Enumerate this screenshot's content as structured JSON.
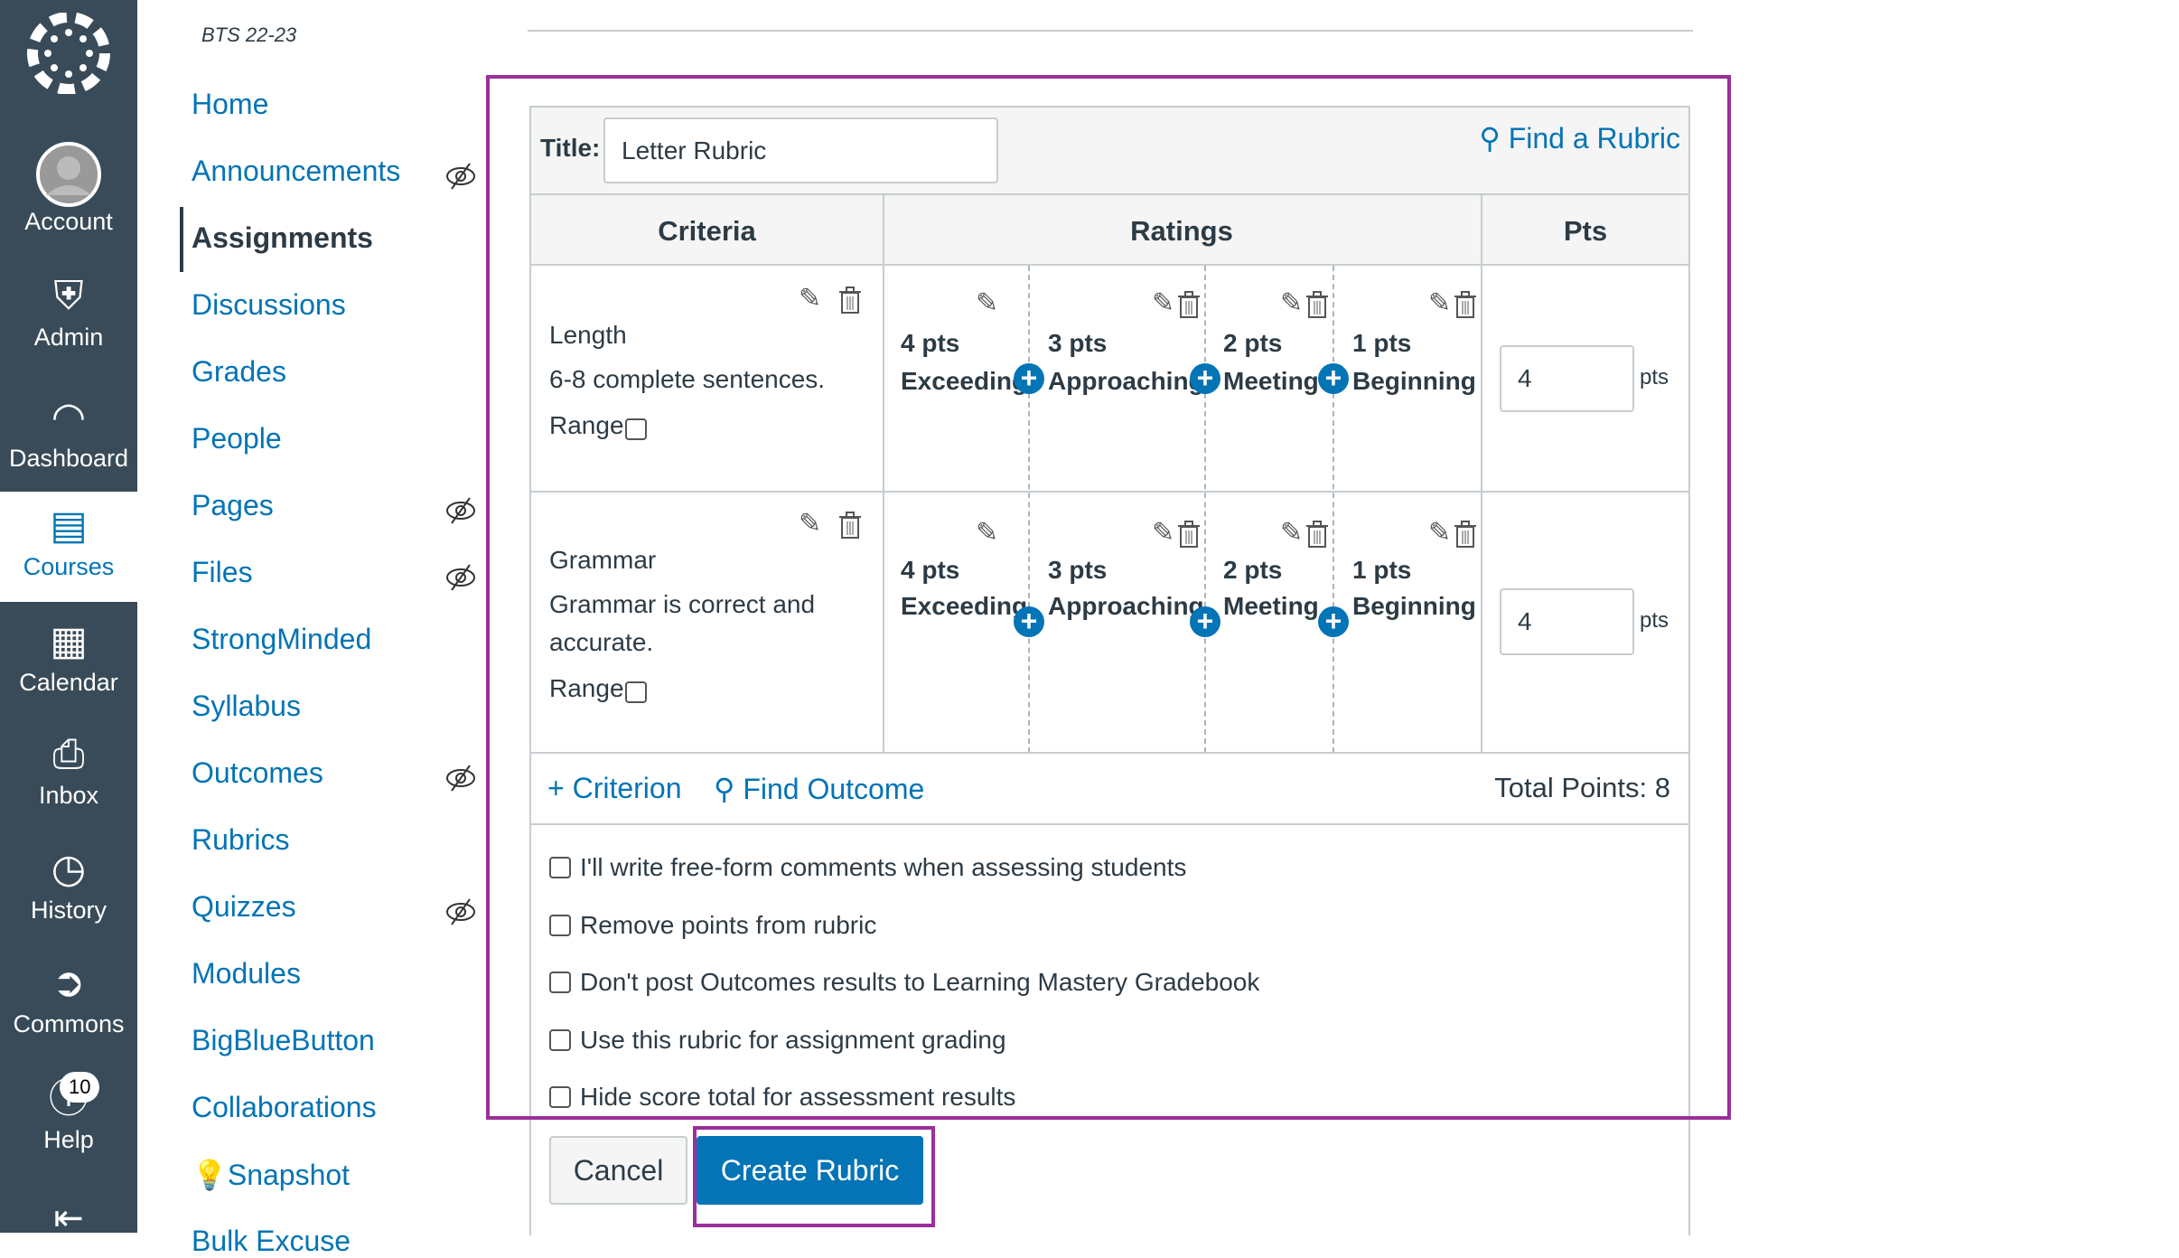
{
  "global_nav": {
    "items": [
      {
        "label": "Account",
        "icon": "user-avatar-icon"
      },
      {
        "label": "Admin",
        "icon": "shield-key-icon"
      },
      {
        "label": "Dashboard",
        "icon": "speedometer-icon"
      },
      {
        "label": "Courses",
        "icon": "book-icon",
        "active": true
      },
      {
        "label": "Calendar",
        "icon": "calendar-icon"
      },
      {
        "label": "Inbox",
        "icon": "inbox-icon"
      },
      {
        "label": "History",
        "icon": "clock-icon"
      },
      {
        "label": "Commons",
        "icon": "commons-icon"
      },
      {
        "label": "Help",
        "icon": "help-icon",
        "badge": "10"
      }
    ],
    "brand_color": "#394b58"
  },
  "course_nav": {
    "course_term": "BTS 22-23",
    "items": [
      {
        "label": "Home"
      },
      {
        "label": "Announcements",
        "hidden": true
      },
      {
        "label": "Assignments",
        "active": true
      },
      {
        "label": "Discussions"
      },
      {
        "label": "Grades"
      },
      {
        "label": "People"
      },
      {
        "label": "Pages",
        "hidden": true
      },
      {
        "label": "Files",
        "hidden": true
      },
      {
        "label": "StrongMinded"
      },
      {
        "label": "Syllabus"
      },
      {
        "label": "Outcomes",
        "hidden": true
      },
      {
        "label": "Rubrics"
      },
      {
        "label": "Quizzes",
        "hidden": true
      },
      {
        "label": "Modules"
      },
      {
        "label": "BigBlueButton"
      },
      {
        "label": "Collaborations"
      },
      {
        "label": "Snapshot"
      },
      {
        "label": "Bulk Excuse"
      }
    ]
  },
  "rubric": {
    "title_label": "Title:",
    "title_value": "Letter Rubric",
    "find_rubric": "Find a Rubric",
    "headers": {
      "criteria": "Criteria",
      "ratings": "Ratings",
      "pts": "Pts"
    },
    "criteria": [
      {
        "name": "Length",
        "description": [
          "6-8 complete sentences."
        ],
        "range_label": "Range",
        "points": "4",
        "pts_unit": "pts",
        "ratings": [
          {
            "pts": "4 pts",
            "label": "Exceeding"
          },
          {
            "pts": "3 pts",
            "label": "Approaching"
          },
          {
            "pts": "2 pts",
            "label": "Meeting"
          },
          {
            "pts": "1 pts",
            "label": "Beginning"
          }
        ]
      },
      {
        "name": "Grammar",
        "description": [
          "Grammar is correct and",
          "accurate."
        ],
        "range_label": "Range",
        "points": "4",
        "pts_unit": "pts",
        "ratings": [
          {
            "pts": "4 pts",
            "label": "Exceeding"
          },
          {
            "pts": "3 pts",
            "label": "Approaching"
          },
          {
            "pts": "2 pts",
            "label": "Meeting"
          },
          {
            "pts": "1 pts",
            "label": "Beginning"
          }
        ]
      }
    ],
    "add_criterion": "Criterion",
    "find_outcome": "Find Outcome",
    "total_points": "Total Points: 8",
    "options": [
      "I'll write free-form comments when assessing students",
      "Remove points from rubric",
      "Don't post Outcomes results to Learning Mastery Gradebook",
      "Use this rubric for assignment grading",
      "Hide score total for assessment results"
    ],
    "cancel": "Cancel",
    "create": "Create Rubric"
  },
  "colors": {
    "link": "#0374b5",
    "highlight": "#9b2f9b",
    "primary_button": "#0374b5"
  }
}
